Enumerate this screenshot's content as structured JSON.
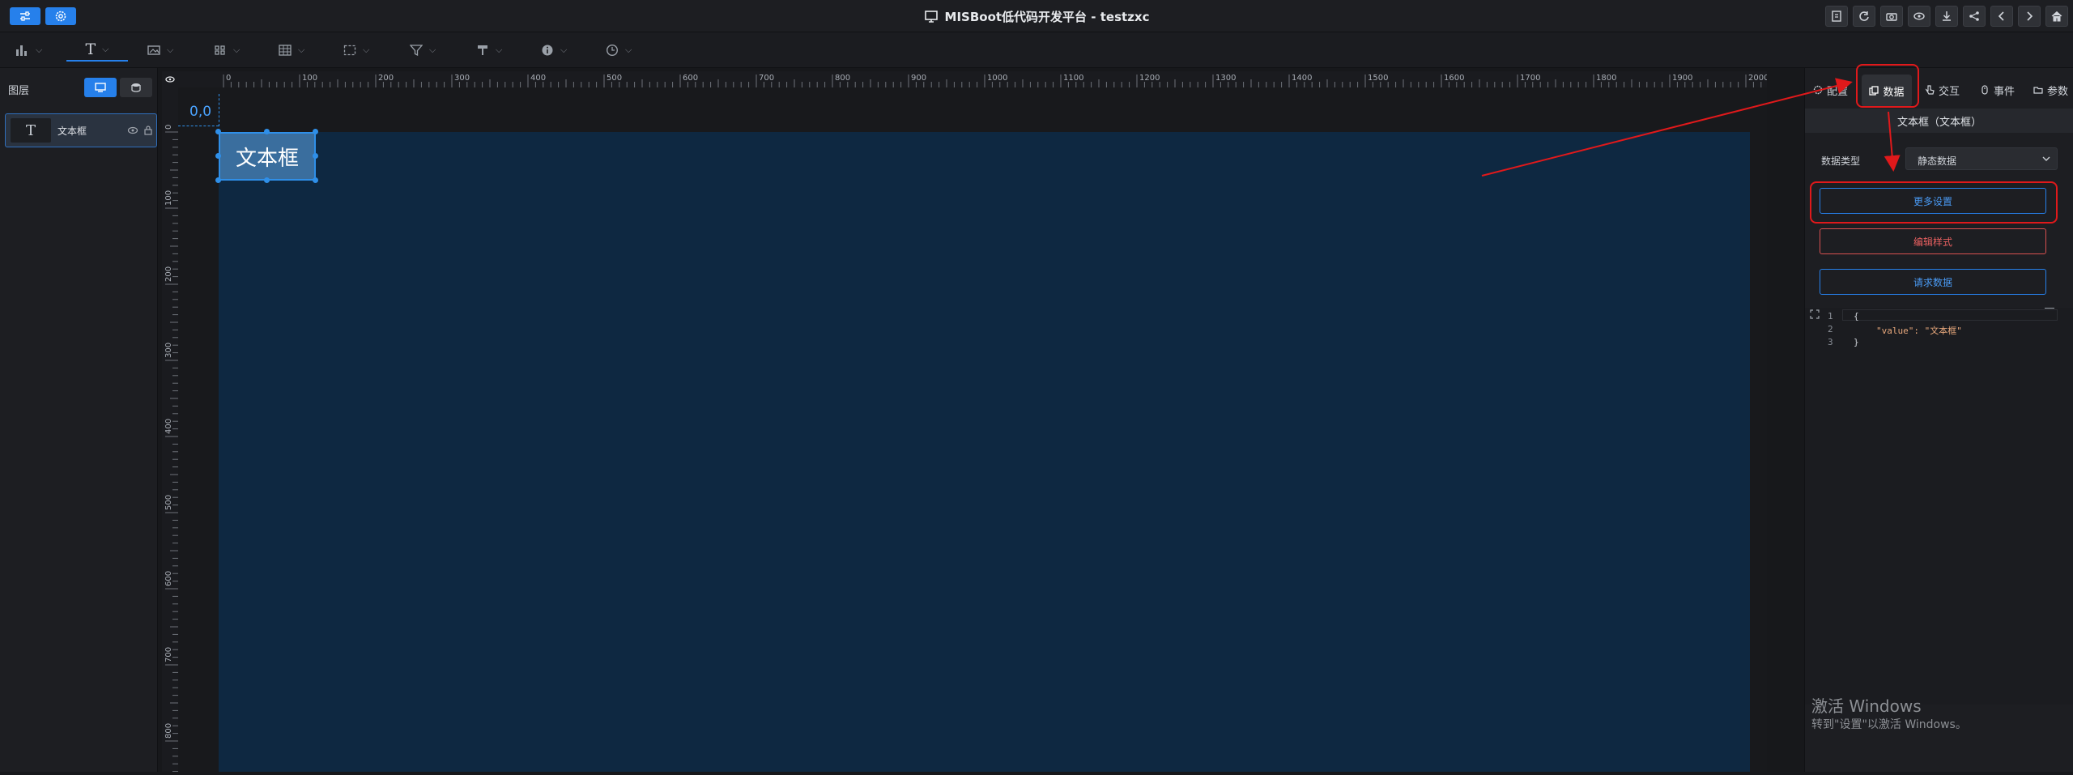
{
  "app": {
    "title": "MISBoot低代码开发平台 - testzxc"
  },
  "leftpanel": {
    "title": "图层",
    "layer_label": "文本框",
    "layer_icon": "T"
  },
  "ruler": {
    "h_ticks": [
      "0",
      "100",
      "200",
      "300",
      "400",
      "500",
      "600",
      "700",
      "800",
      "900",
      "1000",
      "1100",
      "1200",
      "1300",
      "1400",
      "1500",
      "1600",
      "1700",
      "1800",
      "1900",
      "2000"
    ],
    "v_ticks": [
      "0",
      "100",
      "200",
      "300",
      "400",
      "500",
      "600",
      "700",
      "800"
    ],
    "origin": "0,0"
  },
  "canvas": {
    "textbox_text": "文本框",
    "bg_color": "#0e2841"
  },
  "rightpanel": {
    "tabs": [
      "配置",
      "数据",
      "交互",
      "事件",
      "参数"
    ],
    "component_title": "文本框（文本框）",
    "data_type_label": "数据类型",
    "data_type_value": "静态数据",
    "more_settings": "更多设置",
    "edit_style": "编辑样式",
    "request_data": "请求数据",
    "code_lines": [
      "{",
      "\"value\": \"文本框\"",
      "}"
    ],
    "line_numbers": [
      "1",
      "2",
      "3"
    ]
  },
  "watermark": {
    "title": "激活 Windows",
    "subtitle": "转到\"设置\"以激活 Windows。"
  },
  "colors": {
    "accent": "#2680eb",
    "highlight": "#e0191b",
    "danger": "#e05050"
  }
}
